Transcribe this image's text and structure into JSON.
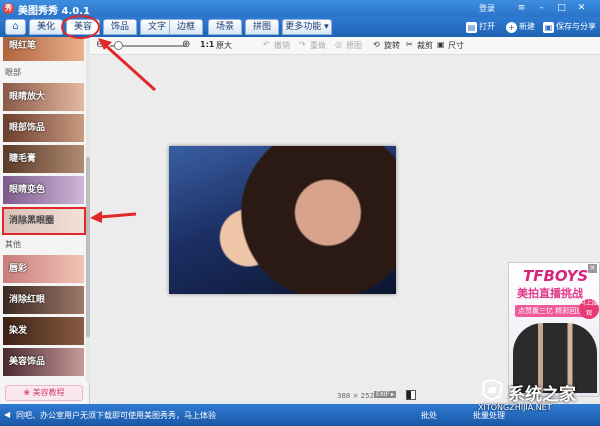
{
  "titlebar": {
    "app_title": "美图秀秀 4.0.1",
    "logo_glyph": "秀",
    "login": "登录"
  },
  "tabs": [
    "美化",
    "美容",
    "饰品",
    "文字",
    "边框",
    "场景",
    "拼图",
    "更多功能 ▾"
  ],
  "active_tab": "美容",
  "right_actions": {
    "open": "打开",
    "new": "新建",
    "save": "保存与分享"
  },
  "controls": {
    "zoom_actual": "1:1",
    "zoom_fit": "原大",
    "undo": "撤销",
    "redo": "重做",
    "original": "原图",
    "rotate": "旋转",
    "crop": "裁剪",
    "size": "尺寸"
  },
  "sidebar": {
    "top_item": "眼红笔",
    "section_eyes": "眼部",
    "eye_items": [
      "眼睛放大",
      "眼部饰品",
      "睫毛膏",
      "眼睛变色",
      "消除黑眼圈"
    ],
    "section_other": "其他",
    "other_items": [
      "唇彩",
      "消除红眼",
      "染发",
      "美容饰品"
    ],
    "tutorial": "美容教程"
  },
  "canvas": {
    "image_size": "388 × 252",
    "exif": "EXIF ▸"
  },
  "ad": {
    "title": "TFBOYS",
    "subtitle": "美拍直播挑战",
    "tag": "点赞赢三亿 精彩回放",
    "badge": "马上围观"
  },
  "status": {
    "message": "同吧、办公室用户无须下载即可使用美图秀秀，马上体验",
    "right1": "批处",
    "right2": "批量处理"
  },
  "watermark": {
    "title": "系统之家",
    "site": "XITONGZHIJIA.NET"
  },
  "colors": {
    "accent": "#2a73c9",
    "annotation": "#e02828"
  }
}
